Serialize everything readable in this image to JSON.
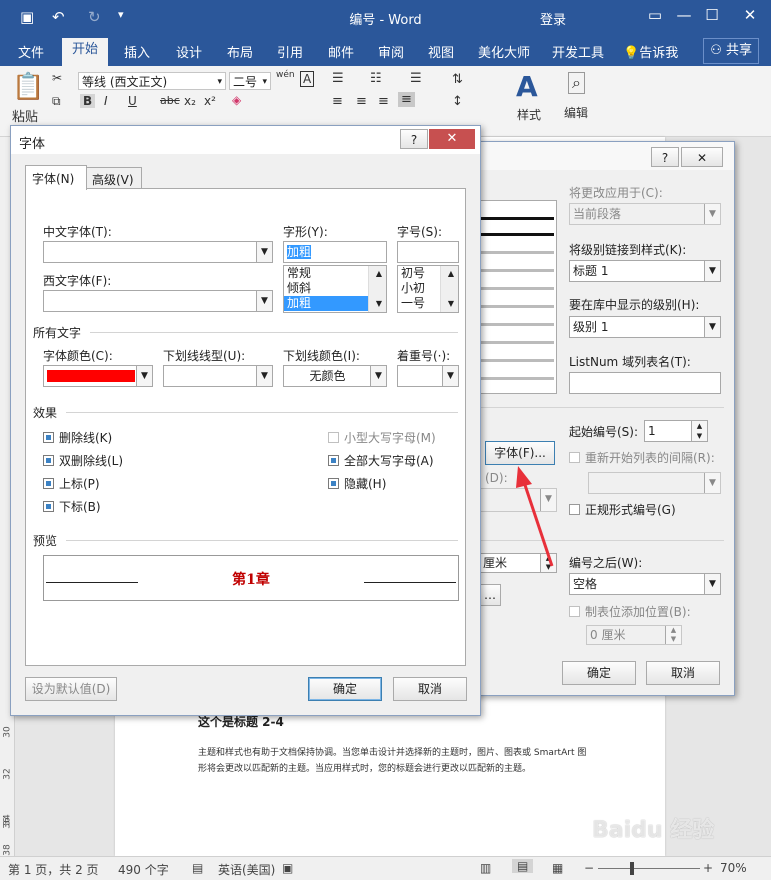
{
  "window": {
    "title": "编号 - Word",
    "login": "登录"
  },
  "ribbon_tabs": [
    "文件",
    "开始",
    "插入",
    "设计",
    "布局",
    "引用",
    "邮件",
    "审阅",
    "视图",
    "美化大师",
    "开发工具",
    "告诉我",
    "共享"
  ],
  "ribbon": {
    "paste_label": "粘贴",
    "font_name": "等线 (西文正文)",
    "font_size": "二号",
    "wen_label": "wén",
    "styles_label": "样式",
    "edit_label": "编辑"
  },
  "font_dialog": {
    "title": "字体",
    "tabs": [
      "字体(N)",
      "高级(V)"
    ],
    "cn_font_label": "中文字体(T):",
    "cn_font_value": "",
    "west_font_label": "西文字体(F):",
    "west_font_value": "",
    "style_label": "字形(Y):",
    "style_value": "加粗",
    "style_options": [
      "常规",
      "倾斜",
      "加粗"
    ],
    "size_label": "字号(S):",
    "size_value": "",
    "size_options": [
      "初号",
      "小初",
      "一号"
    ],
    "all_text_label": "所有文字",
    "font_color_label": "字体颜色(C):",
    "font_color": "#ff0000",
    "underline_type_label": "下划线线型(U):",
    "underline_color_label": "下划线颜色(I):",
    "underline_color_value": "无颜色",
    "emphasis_label": "着重号(·):",
    "effects_label": "效果",
    "effects": [
      {
        "label": "删除线(K)",
        "state": "partial"
      },
      {
        "label": "双删除线(L)",
        "state": "partial"
      },
      {
        "label": "上标(P)",
        "state": "partial"
      },
      {
        "label": "下标(B)",
        "state": "partial"
      },
      {
        "label": "小型大写字母(M)",
        "state": "disabled"
      },
      {
        "label": "全部大写字母(A)",
        "state": "partial"
      },
      {
        "label": "隐藏(H)",
        "state": "partial"
      }
    ],
    "preview_label": "预览",
    "preview_text": "第1章",
    "default_button": "设为默认值(D)",
    "ok_button": "确定",
    "cancel_button": "取消"
  },
  "numbering_dialog": {
    "apply_to_label": "将更改应用于(C):",
    "apply_to_value": "当前段落",
    "link_style_label": "将级别链接到样式(K):",
    "link_style_value": "标题 1",
    "gallery_level_label": "要在库中显示的级别(H):",
    "gallery_level_value": "级别 1",
    "listnum_label": "ListNum 域列表名(T):",
    "listnum_value": "",
    "start_at_label": "起始编号(S):",
    "start_at_value": "1",
    "restart_label": "重新开始列表的间隔(R):",
    "legal_label": "正规形式编号(G)",
    "font_button": "字体(F)...",
    "partial_label": "(D):",
    "partial_value": "厘米",
    "follow_label": "编号之后(W):",
    "follow_value": "空格",
    "tab_stop_label": "制表位添加位置(B):",
    "tab_stop_value": "0 厘米",
    "ok_button": "确定",
    "cancel_button": "取消",
    "close_glyph": "✕",
    "help_glyph": "?"
  },
  "document": {
    "heading": "这个是标题 2-4",
    "body": "主题和样式也有助于文档保持协调。当您单击设计并选择新的主题时，图片、图表或 SmartArt 图形将会更改以匹配新的主题。当应用样式时，您的标题会进行更改以匹配新的主题。",
    "ruler_marks": [
      "30",
      "32",
      "34",
      "36",
      "38"
    ]
  },
  "status": {
    "page": "第 1 页，共 2 页",
    "words": "490 个字",
    "language": "英语(美国)",
    "zoom": "70%"
  },
  "watermark": "Baidu 经验",
  "colors": {
    "accent": "#2b579a",
    "arrow": "#e8303a"
  }
}
